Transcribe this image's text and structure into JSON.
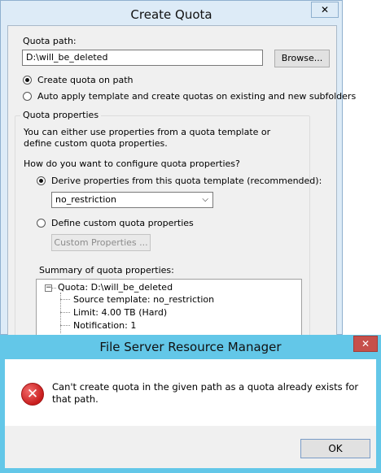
{
  "create_quota": {
    "title": "Create Quota",
    "close_glyph": "✕",
    "quota_path_label": "Quota path:",
    "quota_path_value": "D:\\will_be_deleted",
    "browse_label": "Browse...",
    "radio_create": "Create quota on path",
    "radio_auto": "Auto apply template and create quotas on existing and new subfolders",
    "properties_group": {
      "legend": "Quota properties",
      "description": "You can either use properties from a quota template or define custom quota properties.",
      "question": "How do you want to configure quota properties?",
      "radio_derive": "Derive properties from this quota template (recommended):",
      "template_selected": "no_restriction",
      "radio_custom": "Define custom quota properties",
      "custom_button": "Custom Properties ...",
      "summary_label": "Summary of quota properties:",
      "summary": {
        "root": "Quota: D:\\will_be_deleted",
        "children": [
          "Source template: no_restriction",
          "Limit: 4.00 TB (Hard)",
          "Notification: 1"
        ]
      }
    }
  },
  "message_box": {
    "title": "File Server Resource Manager",
    "close_glyph": "✕",
    "icon": "error-icon",
    "text": "Can't create quota in the given path as a quota already exists for that path.",
    "ok_label": "OK"
  },
  "colors": {
    "window_frame": "#ddebf7",
    "message_frame": "#63c7e8",
    "close_red": "#c6504b",
    "error_red": "#c81d1d"
  }
}
